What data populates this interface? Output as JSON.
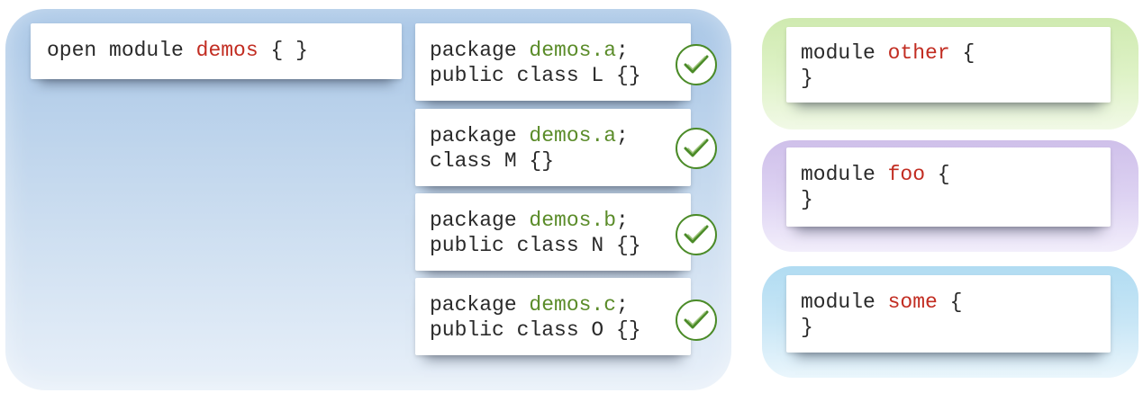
{
  "demos_module": {
    "prefix": "open module ",
    "name": "demos",
    "suffix": " { }"
  },
  "packages": [
    {
      "prefix": "package ",
      "name": "demos.a",
      "semi": ";",
      "line2": "public class L {}",
      "status": "check"
    },
    {
      "prefix": "package ",
      "name": "demos.a",
      "semi": ";",
      "line2": "class M {}",
      "status": "check"
    },
    {
      "prefix": "package ",
      "name": "demos.b",
      "semi": ";",
      "line2": "public class N {}",
      "status": "check"
    },
    {
      "prefix": "package ",
      "name": "demos.c",
      "semi": ";",
      "line2": "public class O {}",
      "status": "check"
    }
  ],
  "other_modules": [
    {
      "prefix": "module ",
      "name": "other",
      "open": " {",
      "close": "}"
    },
    {
      "prefix": "module ",
      "name": "foo",
      "open": " {",
      "close": "}"
    },
    {
      "prefix": "module ",
      "name": "some",
      "open": " {",
      "close": "}"
    }
  ],
  "colors": {
    "module_name": "#c22d22",
    "package_name": "#5b8c2a",
    "check": "#4b8b28"
  }
}
